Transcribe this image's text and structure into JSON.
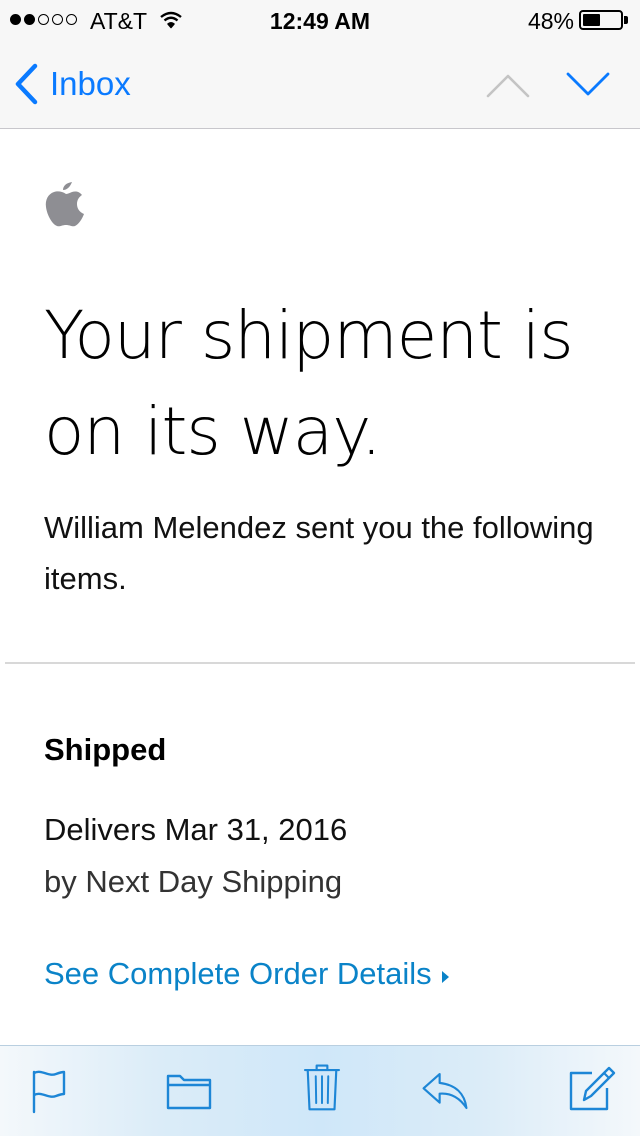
{
  "status_bar": {
    "signal_strength": 2,
    "signal_total": 5,
    "carrier": "AT&T",
    "time": "12:49 AM",
    "battery_percent": "48%",
    "battery_level": 0.48
  },
  "nav": {
    "back_label": "Inbox",
    "prev_icon": "chevron-up-icon",
    "next_icon": "chevron-down-icon"
  },
  "email": {
    "logo_icon": "apple-logo-icon",
    "headline": "Your shipment is on its way.",
    "intro": "William Melendez sent you the following items.",
    "status_heading": "Shipped",
    "delivery_date": "Delivers Mar 31, 2016",
    "shipping_method": "by Next Day Shipping",
    "order_link": "See Complete Order Details"
  },
  "toolbar": {
    "items": [
      "flag-icon",
      "folder-icon",
      "trash-icon",
      "reply-icon",
      "compose-icon"
    ]
  },
  "colors": {
    "accent": "#0a7aff",
    "link": "#0a83c8",
    "toolbar_icon": "#1d86d6",
    "logo": "#8e8e93"
  }
}
